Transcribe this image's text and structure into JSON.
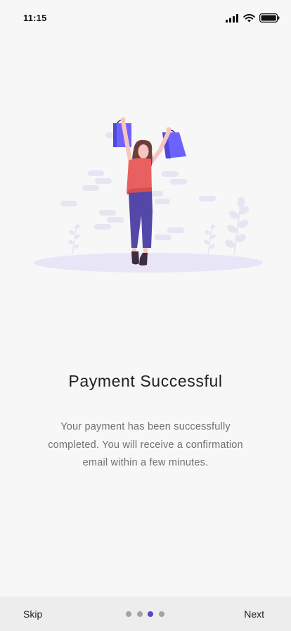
{
  "status_bar": {
    "time": "11:15",
    "icons": [
      "signal-icon",
      "wifi-icon",
      "battery-icon"
    ]
  },
  "illustration": {
    "name": "woman-celebrating-with-shopping-bags",
    "colors": {
      "bags": "#6c63ff",
      "shirt": "#e8605f",
      "pants": "#5348a8",
      "ground": "#e8e6f6",
      "bricks": "#e6e5f1"
    }
  },
  "content": {
    "title": "Payment Successful",
    "message": "Your payment has been successfully completed. You will receive a confirmation email within a few minutes."
  },
  "footer": {
    "skip_label": "Skip",
    "next_label": "Next",
    "page_count": 4,
    "active_page": 3
  },
  "colors": {
    "background": "#f7f7f7",
    "footer_bg": "#ededed",
    "accent": "#5348c9",
    "dot_inactive": "#a3a3a3"
  }
}
